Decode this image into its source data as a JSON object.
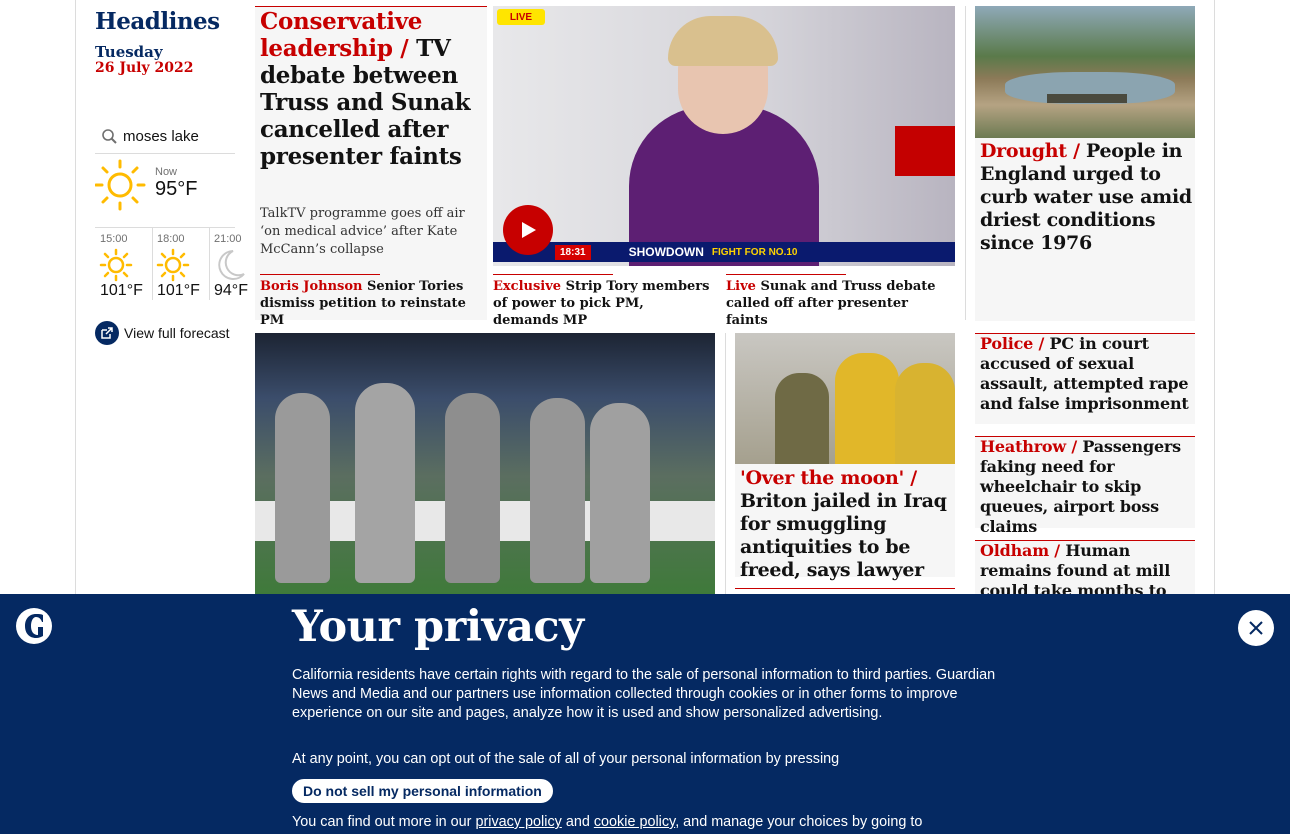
{
  "sidebar": {
    "title": "Headlines",
    "weekday": "Tuesday",
    "date": "26 July 2022",
    "location": "moses lake",
    "now_label": "Now",
    "now_temp": "95°F",
    "forecast": [
      {
        "time": "15:00",
        "temp": "101°F",
        "icon": "sun-icon"
      },
      {
        "time": "18:00",
        "temp": "101°F",
        "icon": "sun-icon"
      },
      {
        "time": "21:00",
        "temp": "94°F",
        "icon": "moon-icon"
      }
    ],
    "full_forecast": "View full forecast"
  },
  "lead": {
    "kicker": "Conservative leadership /",
    "headline": "TV debate between Truss and Sunak cancelled after presenter faints",
    "standfirst": "TalkTV programme goes off air ‘on medical advice’ after Kate McCann’s collapse",
    "live_badge": "LIVE",
    "video_caption": "18:31",
    "video_ticker": "SHOWDOWN",
    "video_ticker2": "FIGHT FOR NO.10",
    "sublinks": [
      {
        "kicker": "Boris Johnson",
        "text": "Senior Tories dismiss petition to reinstate PM"
      },
      {
        "kicker": "Exclusive",
        "text": "Strip Tory members of power to pick PM, demands MP"
      },
      {
        "kicker": "Live",
        "text": "Sunak and Truss debate called off after presenter faints"
      }
    ]
  },
  "right_top": {
    "kicker": "Drought /",
    "headline": "People in England urged to curb water use amid driest conditions since 1976"
  },
  "iraq": {
    "kicker": "'Over the moon' /",
    "headline": "Briton jailed in Iraq for smuggling antiquities to be freed, says lawyer"
  },
  "right_list": [
    {
      "kicker": "Police /",
      "headline": "PC in court accused of sexual assault, attempted rape and false imprisonment"
    },
    {
      "kicker": "Heathrow /",
      "headline": "Passengers faking need for wheelchair to skip queues, airport boss claims"
    },
    {
      "kicker": "Oldham /",
      "headline": "Human remains found at mill could take months to identify"
    }
  ],
  "privacy": {
    "title": "Your privacy",
    "body": "California residents have certain rights with regard to the sale of personal information to third parties. Guardian News and Media and our partners use information collected through cookies or in other forms to improve experience on our site and pages, analyze how it is used and show personalized advertising.",
    "optout": "At any point, you can opt out of the sale of all of your personal information by pressing",
    "button": "Do not sell my personal information",
    "more_prefix": "You can find out more in our",
    "privacy_link": "privacy policy",
    "and": "and",
    "cookie_link": "cookie policy",
    "more_suffix": ", and manage your choices by going to"
  },
  "colors": {
    "brand": "#052962",
    "news_red": "#c70000"
  }
}
